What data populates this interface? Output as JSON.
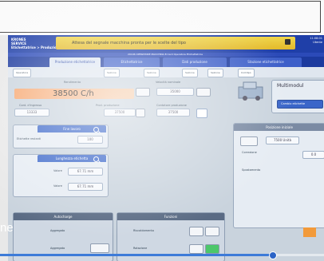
{
  "header": {
    "logo_line1": "KRONES",
    "logo_line2": "SERVICE",
    "logo_line3": "Etichettatrice > Produzione",
    "banner_text": "Attesa del segnale macchina pronta per le scelte del tipo",
    "clock_time": "11:08:01",
    "clock_user": "Utente",
    "info_text": "20106 OPERATORE MACCHINA B Card Operatore Etichettatrice"
  },
  "tabs": [
    {
      "label": "Produzione etichettatrice"
    },
    {
      "label": "Etichettatrice"
    },
    {
      "label": "Dati produzione"
    },
    {
      "label": "Stazione etichettatrice"
    }
  ],
  "toolbar": {
    "item1": "Operatore",
    "item2": "Sezione",
    "item3": "Sezione",
    "item4": "Sezione",
    "item5": "Sezione",
    "item6": "Cod.tipo"
  },
  "speed": {
    "label": "Rendimento",
    "value": "38500 C/h",
    "set_label": "Velocità nominale",
    "set_value": "35000"
  },
  "counters": {
    "label1": "Cont. d'ingresso",
    "value1": "13333",
    "label2": "Prod. produzione",
    "value2": "37500",
    "label3": "Contatore produzione",
    "value3": "37500"
  },
  "multimodule": {
    "title": "Multimodul",
    "button": "Cambio etichette"
  },
  "fine_lavoro": {
    "title": "Fine lavoro",
    "label": "Etichette restanti",
    "value": "100"
  },
  "lunghezza": {
    "title": "Lunghezza etichetta",
    "label1": "Valore",
    "value1": "67.71 mm",
    "label2": "Valore",
    "value2": "67.71 mm"
  },
  "posizione": {
    "title": "Posizione iniziale",
    "value": "7500 Unità",
    "label1": "Correzione",
    "value1": "0.0",
    "label2": "Spostamento"
  },
  "autocharge": {
    "title": "Autocharge",
    "row1": "Aggregato",
    "row2": "Aggregato"
  },
  "funzioni": {
    "title": "Funzioni",
    "row1": "Riscaldamento",
    "row2": "Rotazione"
  },
  "overlay": {
    "text": "ne"
  },
  "video": {
    "progress": 0.84
  }
}
